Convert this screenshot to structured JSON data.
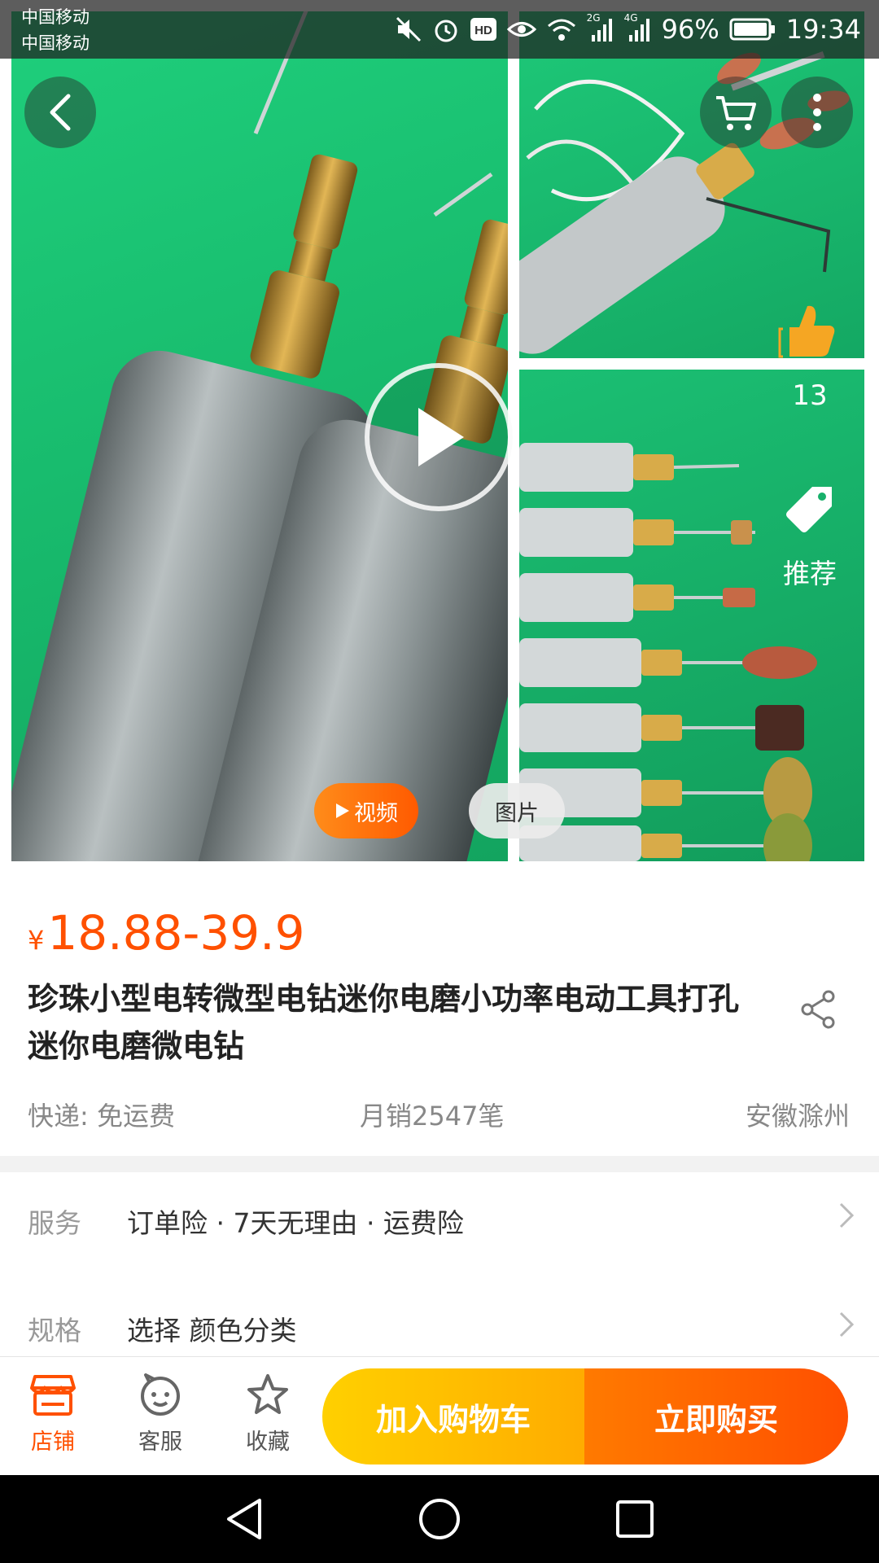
{
  "status_bar": {
    "carrier_1": "中国移动",
    "carrier_2": "中国移动",
    "net_2g": "2G",
    "net_4g": "4G",
    "battery": "96%",
    "time": "19:34",
    "icons": [
      "mute-icon",
      "alarm-icon",
      "hd-icon",
      "eye-icon",
      "wifi-icon",
      "signal-icon",
      "signal-icon",
      "battery-icon"
    ]
  },
  "gallery": {
    "recommend_count": "13",
    "recommend_label": "推荐",
    "video_tab": "视频",
    "image_tab": "图片"
  },
  "product": {
    "currency": "¥",
    "price": "18.88-39.9",
    "title": "珍珠小型电转微型电钻迷你电磨小功率电动工具打孔迷你电磨微电钻",
    "shipping": "快递: 免运费",
    "monthly_sales": "月销2547笔",
    "location": "安徽滁州"
  },
  "service_row": {
    "label": "服务",
    "value": "订单险 · 7天无理由 · 运费险"
  },
  "spec_row": {
    "label": "规格",
    "value": "选择 颜色分类"
  },
  "action_bar": {
    "shop": "店铺",
    "customer_service": "客服",
    "favorite": "收藏",
    "add_to_cart": "加入购物车",
    "buy_now": "立即购买"
  },
  "colors": {
    "accent": "#ff5000",
    "cart_button": "#ffb400",
    "buy_button": "#ff5a00",
    "product_bg": "#1bbf73"
  }
}
